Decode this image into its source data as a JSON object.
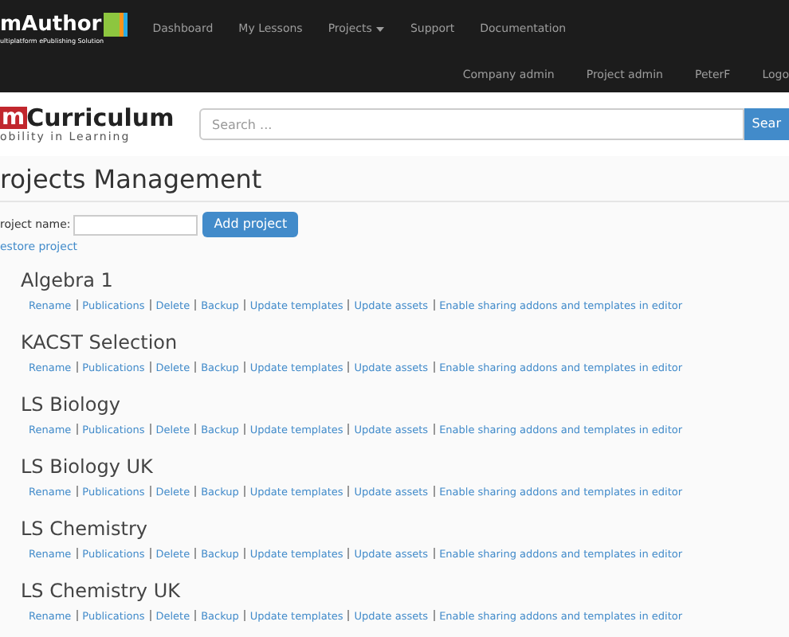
{
  "navbar": {
    "logo": {
      "prefix": "m",
      "name": "Author",
      "tagline": "ultiplatform ePublishing Solution"
    },
    "items": [
      {
        "label": "Dashboard",
        "dropdown": false
      },
      {
        "label": "My Lessons",
        "dropdown": false
      },
      {
        "label": "Projects",
        "dropdown": true
      },
      {
        "label": "Support",
        "dropdown": false
      },
      {
        "label": "Documentation",
        "dropdown": false
      }
    ],
    "user_items": [
      "Company admin",
      "Project admin",
      "PeterF",
      "Logo"
    ]
  },
  "header": {
    "logo": {
      "prefix": "m",
      "name": "Curriculum",
      "tagline": "obility in Learning"
    },
    "search": {
      "placeholder": "Search ...",
      "button": "Sear"
    }
  },
  "page": {
    "title": "rojects Management",
    "form": {
      "label": "roject name:",
      "button": "Add project"
    },
    "restore_link": "estore project"
  },
  "projects": [
    {
      "name": "Algebra 1",
      "actions": [
        "Rename",
        "Publications",
        "Delete",
        "Backup",
        "Update templates",
        "Update assets",
        "Enable sharing addons and templates in editor"
      ]
    },
    {
      "name": "KACST Selection",
      "actions": [
        "Rename",
        "Publications",
        "Delete",
        "Backup",
        "Update templates",
        "Update assets",
        "Enable sharing addons and templates in editor"
      ]
    },
    {
      "name": "LS Biology",
      "actions": [
        "Rename",
        "Publications",
        "Delete",
        "Backup",
        "Update templates",
        "Update assets",
        "Enable sharing addons and templates in editor"
      ]
    },
    {
      "name": "LS Biology UK",
      "actions": [
        "Rename",
        "Publications",
        "Delete",
        "Backup",
        "Update templates",
        "Update assets",
        "Enable sharing addons and templates in editor"
      ]
    },
    {
      "name": "LS Chemistry",
      "actions": [
        "Rename",
        "Publications",
        "Delete",
        "Backup",
        "Update templates",
        "Update assets",
        "Enable sharing addons and templates in editor"
      ]
    },
    {
      "name": "LS Chemistry UK",
      "actions": [
        "Rename",
        "Publications",
        "Delete",
        "Backup",
        "Update templates",
        "Update assets",
        "Enable sharing addons and templates in editor"
      ]
    }
  ]
}
